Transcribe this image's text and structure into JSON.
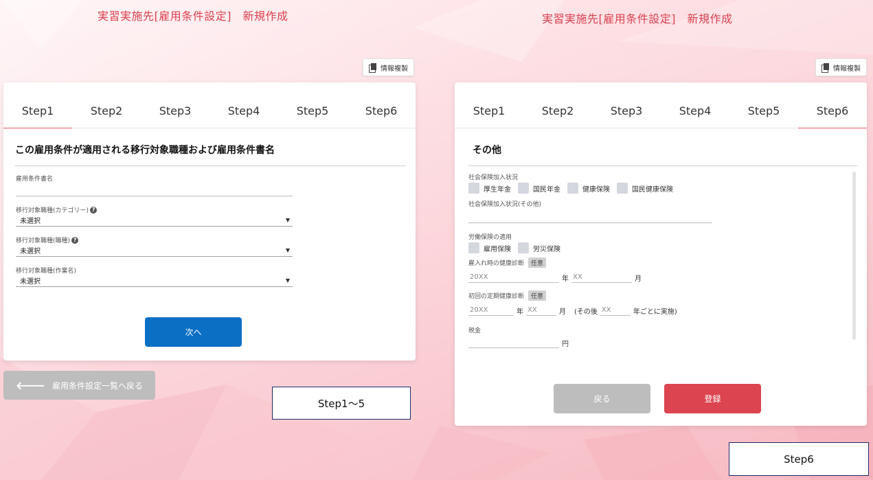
{
  "left": {
    "page_title": "実習実施先[雇用条件設定]　新規作成",
    "copy_button_label": "情報複製",
    "tabs": [
      "Step1",
      "Step2",
      "Step3",
      "Step4",
      "Step5",
      "Step6"
    ],
    "active_tab": 0,
    "section_title": "この雇用条件が適用される移行対象職種および雇用条件書名",
    "fields": {
      "doc_name_label": "雇用条件書名",
      "doc_name_value": "",
      "category_label": "移行対象職種(カテゴリー)",
      "category_value": "未選択",
      "job_label": "移行対象職種(職種)",
      "job_value": "未選択",
      "work_label": "移行対象職種(作業名)",
      "work_value": "未選択"
    },
    "next_button_label": "次へ",
    "back_list_button_label": "雇用条件設定一覧へ戻る",
    "caption": "Step1～5"
  },
  "right": {
    "page_title": "実習実施先[雇用条件設定]　新規作成",
    "copy_button_label": "情報複製",
    "tabs": [
      "Step1",
      "Step2",
      "Step3",
      "Step4",
      "Step5",
      "Step6"
    ],
    "active_tab": 5,
    "section_title": "その他",
    "social_insurance": {
      "label": "社会保険加入状況",
      "options": [
        "厚生年金",
        "国民年金",
        "健康保険",
        "国民健康保険"
      ],
      "other_label": "社会保険加入状況(その他)",
      "other_value": ""
    },
    "labor_insurance": {
      "label": "労働保険の適用",
      "options": [
        "雇用保険",
        "労災保険"
      ]
    },
    "hire_checkup": {
      "label": "雇入れ時の健康診断",
      "badge": "任意",
      "year_placeholder": "20XX",
      "year_unit": "年",
      "month_placeholder": "XX",
      "month_unit": "月"
    },
    "periodic_checkup": {
      "label": "初回の定期健康診断",
      "badge": "任意",
      "year_placeholder": "20XX",
      "year_unit": "年",
      "month_placeholder": "XX",
      "month_unit": "月",
      "after_prefix": "(その後",
      "interval_placeholder": "XX",
      "interval_suffix": "年ごとに実施)"
    },
    "tax": {
      "label": "税金",
      "value": "",
      "unit": "円"
    },
    "back_button_label": "戻る",
    "register_button_label": "登録",
    "caption": "Step6"
  },
  "colors": {
    "title": "#d9414f",
    "primary": "#0b6fc4",
    "danger": "#dc4450",
    "muted": "#bdbdbd",
    "tab_active_line": "#e05a63"
  }
}
